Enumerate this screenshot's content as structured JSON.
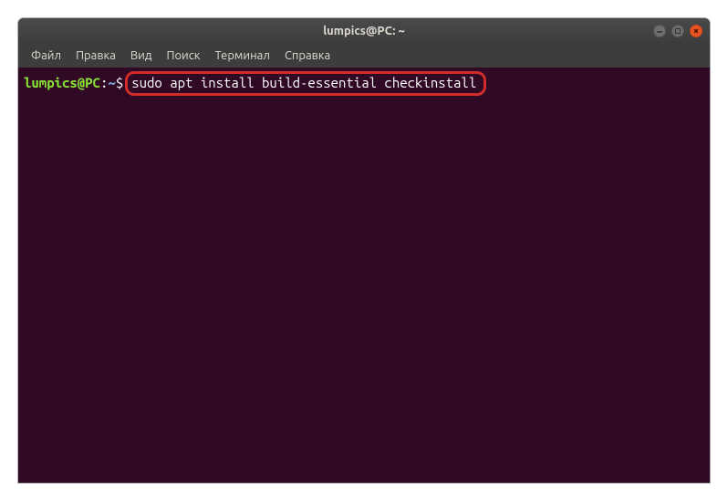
{
  "window": {
    "title": "lumpics@PC: ~"
  },
  "menubar": {
    "items": [
      {
        "label": "Файл"
      },
      {
        "label": "Правка"
      },
      {
        "label": "Вид"
      },
      {
        "label": "Поиск"
      },
      {
        "label": "Терминал"
      },
      {
        "label": "Справка"
      }
    ]
  },
  "terminal": {
    "prompt": {
      "user_host": "lumpics@PC",
      "colon": ":",
      "path": "~",
      "symbol": "$"
    },
    "command": "sudo apt install build-essential checkinstall"
  }
}
